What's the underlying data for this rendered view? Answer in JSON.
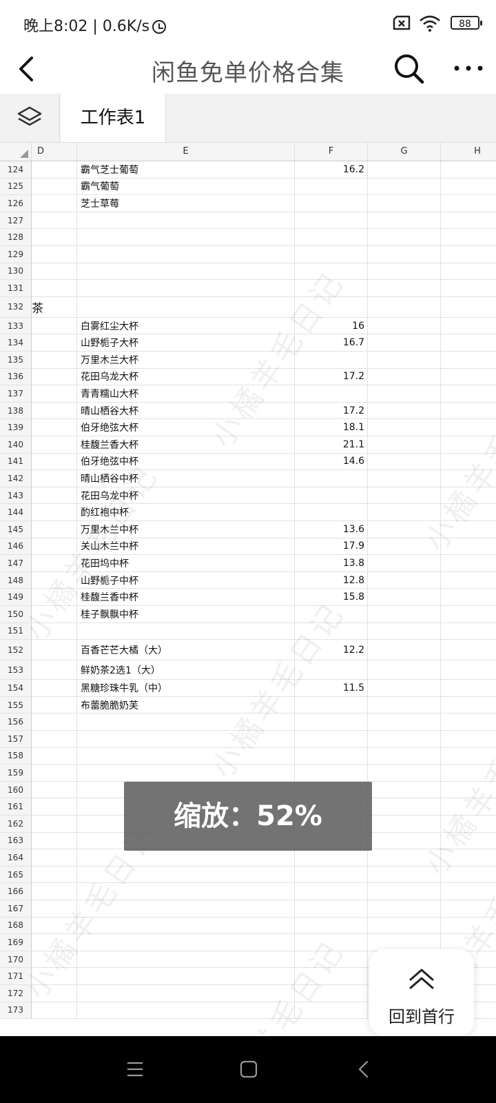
{
  "status_bar": {
    "time_speed": "晚上8:02 | 0.6K/s",
    "battery": "88"
  },
  "header": {
    "title": "闲鱼免单价格合集"
  },
  "tabs": {
    "sheet": "工作表1"
  },
  "columns": [
    "D",
    "E",
    "F",
    "G",
    "H"
  ],
  "rows": [
    {
      "n": "124",
      "d": "",
      "e": "霸气芝士葡萄",
      "f": "16.2"
    },
    {
      "n": "125",
      "d": "",
      "e": "霸气葡萄",
      "f": ""
    },
    {
      "n": "126",
      "d": "",
      "e": "芝士草莓",
      "f": ""
    },
    {
      "n": "127",
      "d": "",
      "e": "",
      "f": ""
    },
    {
      "n": "128",
      "d": "",
      "e": "",
      "f": ""
    },
    {
      "n": "129",
      "d": "",
      "e": "",
      "f": ""
    },
    {
      "n": "130",
      "d": "",
      "e": "",
      "f": ""
    },
    {
      "n": "131",
      "d": "",
      "e": "",
      "f": ""
    },
    {
      "n": "132",
      "d": "茶",
      "e": "",
      "f": ""
    },
    {
      "n": "133",
      "d": "",
      "e": "白雾红尘大杯",
      "f": "16"
    },
    {
      "n": "134",
      "d": "",
      "e": "山野栀子大杯",
      "f": "16.7"
    },
    {
      "n": "135",
      "d": "",
      "e": "万里木兰大杯",
      "f": ""
    },
    {
      "n": "136",
      "d": "",
      "e": "花田乌龙大杯",
      "f": "17.2"
    },
    {
      "n": "137",
      "d": "",
      "e": "青青糯山大杯",
      "f": ""
    },
    {
      "n": "138",
      "d": "",
      "e": "晴山栖谷大杯",
      "f": "17.2"
    },
    {
      "n": "139",
      "d": "",
      "e": "伯牙绝弦大杯",
      "f": "18.1"
    },
    {
      "n": "140",
      "d": "",
      "e": "桂馥兰香大杯",
      "f": "21.1"
    },
    {
      "n": "141",
      "d": "",
      "e": "伯牙绝弦中杯",
      "f": "14.6"
    },
    {
      "n": "142",
      "d": "",
      "e": "晴山栖谷中杯",
      "f": ""
    },
    {
      "n": "143",
      "d": "",
      "e": "花田乌龙中杯",
      "f": ""
    },
    {
      "n": "144",
      "d": "",
      "e": "酌红袍中杯",
      "f": ""
    },
    {
      "n": "145",
      "d": "",
      "e": "万里木兰中杯",
      "f": "13.6"
    },
    {
      "n": "146",
      "d": "",
      "e": "关山木兰中杯",
      "f": "17.9"
    },
    {
      "n": "147",
      "d": "",
      "e": "花田坞中杯",
      "f": "13.8"
    },
    {
      "n": "148",
      "d": "",
      "e": "山野栀子中杯",
      "f": "12.8"
    },
    {
      "n": "149",
      "d": "",
      "e": "桂馥兰香中杯",
      "f": "15.8"
    },
    {
      "n": "150",
      "d": "",
      "e": "桂子飘飘中杯",
      "f": ""
    },
    {
      "n": "151",
      "d": "",
      "e": "",
      "f": ""
    },
    {
      "n": "152",
      "d": "",
      "e": "百香芒芒大橘（大）",
      "f": "12.2"
    },
    {
      "n": "153",
      "d": "",
      "e": "鲜奶茶2选1（大）",
      "f": ""
    },
    {
      "n": "154",
      "d": "",
      "e": "黑糖珍珠牛乳（中）",
      "f": "11.5"
    },
    {
      "n": "155",
      "d": "",
      "e": "布蕾脆脆奶芙",
      "f": ""
    },
    {
      "n": "156",
      "d": "",
      "e": "",
      "f": ""
    },
    {
      "n": "157",
      "d": "",
      "e": "",
      "f": ""
    },
    {
      "n": "158",
      "d": "",
      "e": "",
      "f": ""
    },
    {
      "n": "159",
      "d": "",
      "e": "",
      "f": ""
    },
    {
      "n": "160",
      "d": "",
      "e": "",
      "f": ""
    },
    {
      "n": "161",
      "d": "",
      "e": "",
      "f": ""
    },
    {
      "n": "162",
      "d": "",
      "e": "",
      "f": ""
    },
    {
      "n": "163",
      "d": "",
      "e": "",
      "f": ""
    },
    {
      "n": "164",
      "d": "",
      "e": "",
      "f": ""
    },
    {
      "n": "165",
      "d": "",
      "e": "",
      "f": ""
    },
    {
      "n": "166",
      "d": "",
      "e": "",
      "f": ""
    },
    {
      "n": "167",
      "d": "",
      "e": "",
      "f": ""
    },
    {
      "n": "168",
      "d": "",
      "e": "",
      "f": ""
    },
    {
      "n": "169",
      "d": "",
      "e": "",
      "f": ""
    },
    {
      "n": "170",
      "d": "",
      "e": "",
      "f": ""
    },
    {
      "n": "171",
      "d": "",
      "e": "",
      "f": ""
    },
    {
      "n": "172",
      "d": "",
      "e": "",
      "f": ""
    },
    {
      "n": "173",
      "d": "",
      "e": "",
      "f": ""
    }
  ],
  "watermark": "小橘羊毛日记",
  "zoom_toast": "缩放：52%",
  "back_to_top": "回到首行"
}
